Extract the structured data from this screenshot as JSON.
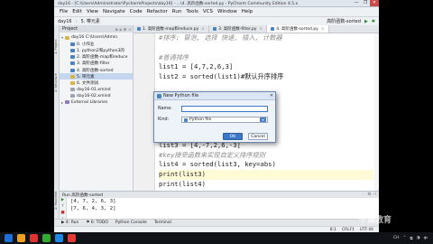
{
  "window": {
    "title": "day16 - [C:\\Users\\Administrator\\PycharmProjects\\day16] - ...\\4. 高阶函数-sorted.py - PyCharm Community Edition 4.5.x",
    "controls": [
      "—",
      "❐",
      "✕"
    ]
  },
  "menu": [
    "File",
    "Edit",
    "View",
    "Navigate",
    "Code",
    "Refactor",
    "Run",
    "Tools",
    "VCS",
    "Window",
    "Help"
  ],
  "toolbar": {
    "breadcrumbs": [
      "day16",
      "5. 带元素"
    ],
    "run_config": "高阶函数-sorted"
  },
  "side_tabs": [
    "1: Project",
    "2: Structure",
    "2: Favorites"
  ],
  "project": {
    "header": "Project",
    "tools": "⊕ ≑ ⚙ ⊣",
    "tree": [
      {
        "label": "day16  C:\\Users\\Admin",
        "icon": "folder",
        "arrow": "▾",
        "indent": 0
      },
      {
        "label": "0. 小作业",
        "icon": "pyfile",
        "arrow": "",
        "indent": 1
      },
      {
        "label": "1. python2和python3的",
        "icon": "pyfile",
        "arrow": "",
        "indent": 1
      },
      {
        "label": "2. 高阶函数-map和reduce",
        "icon": "pyfile",
        "arrow": "",
        "indent": 1
      },
      {
        "label": "3. 高阶函数-filter",
        "icon": "pyfile",
        "arrow": "",
        "indent": 1
      },
      {
        "label": "4. 高阶函数-sorted",
        "icon": "pyfile",
        "arrow": "",
        "indent": 1
      },
      {
        "label": "5. 带元素",
        "icon": "folder",
        "arrow": "",
        "indent": 1,
        "selected": true
      },
      {
        "label": "6. 文件测试",
        "icon": "folder",
        "arrow": "",
        "indent": 1
      },
      {
        "label": "day16-01.xmind",
        "icon": "txt",
        "arrow": "",
        "indent": 1
      },
      {
        "label": "day16-02.xmind",
        "icon": "txt",
        "arrow": "",
        "indent": 1
      },
      {
        "label": "External Libraries",
        "icon": "lib",
        "arrow": "▸",
        "indent": 0
      }
    ]
  },
  "editor": {
    "tabs": [
      {
        "label": "1. 高阶函数-map和reduce.py",
        "active": false
      },
      {
        "label": "3. 高阶函数-filter.py",
        "active": false
      },
      {
        "label": "4. 高阶函数-sorted.py",
        "active": true
      }
    ],
    "lines": [
      {
        "text": "#排序: 冒泡, 选择   快速, 插入, 计数器",
        "type": "comment"
      },
      {
        "text": "",
        "type": "code"
      },
      {
        "text": "#普通排序",
        "type": "comment"
      },
      {
        "text": "list1 = [4,7,2,6,3]",
        "type": "code"
      },
      {
        "text": "list2 = sorted(list1)#默认升序排序",
        "type": "code"
      },
      {
        "text": "",
        "type": "code"
      },
      {
        "text": "",
        "type": "code"
      },
      {
        "text": "",
        "type": "code"
      },
      {
        "text": "",
        "type": "code"
      },
      {
        "text": "",
        "type": "code"
      },
      {
        "text": "",
        "type": "code"
      },
      {
        "text": "list3 = [4,-7,2,6,-3]",
        "type": "code"
      },
      {
        "text": "#key接受函数来实现自定义排序规则",
        "type": "comment"
      },
      {
        "text": "list4 = sorted(list3, key=abs)",
        "type": "code"
      },
      {
        "text": "print(list3)",
        "type": "code",
        "highlight": true
      },
      {
        "text": "print(list4)",
        "type": "code"
      }
    ]
  },
  "run": {
    "title": "Run  高阶函数-sorted",
    "tools": "⚙ ⊣",
    "side": [
      "▶",
      "↑",
      "■",
      "↓"
    ],
    "output": [
      "[4, 7, 2, 6, 3]",
      "[7, 6, 4, 3, 2]"
    ]
  },
  "bottom_tabs": [
    "▶ 4: Run",
    "⚑ 6: TODO",
    "Python Console",
    "Terminal"
  ],
  "status": {
    "position": "8:1",
    "line_sep": "CRLF‡",
    "encoding": "UTF-8‡"
  },
  "dialog": {
    "title": "New Python file",
    "close": "✕",
    "name_label": "Name:",
    "name_value": "",
    "kind_label": "Kind:",
    "kind_value": "Python file",
    "ok": "OK",
    "cancel": "Cancel"
  },
  "taskbar": {
    "icons": [
      "#1e6fd9",
      "#f0a020",
      "#d33",
      "#3a3",
      "#1e88e5",
      "#e53935"
    ],
    "tray": [
      "CH",
      "⌃",
      "⧉",
      "◑",
      "中"
    ]
  },
  "watermark": "千锋教育"
}
